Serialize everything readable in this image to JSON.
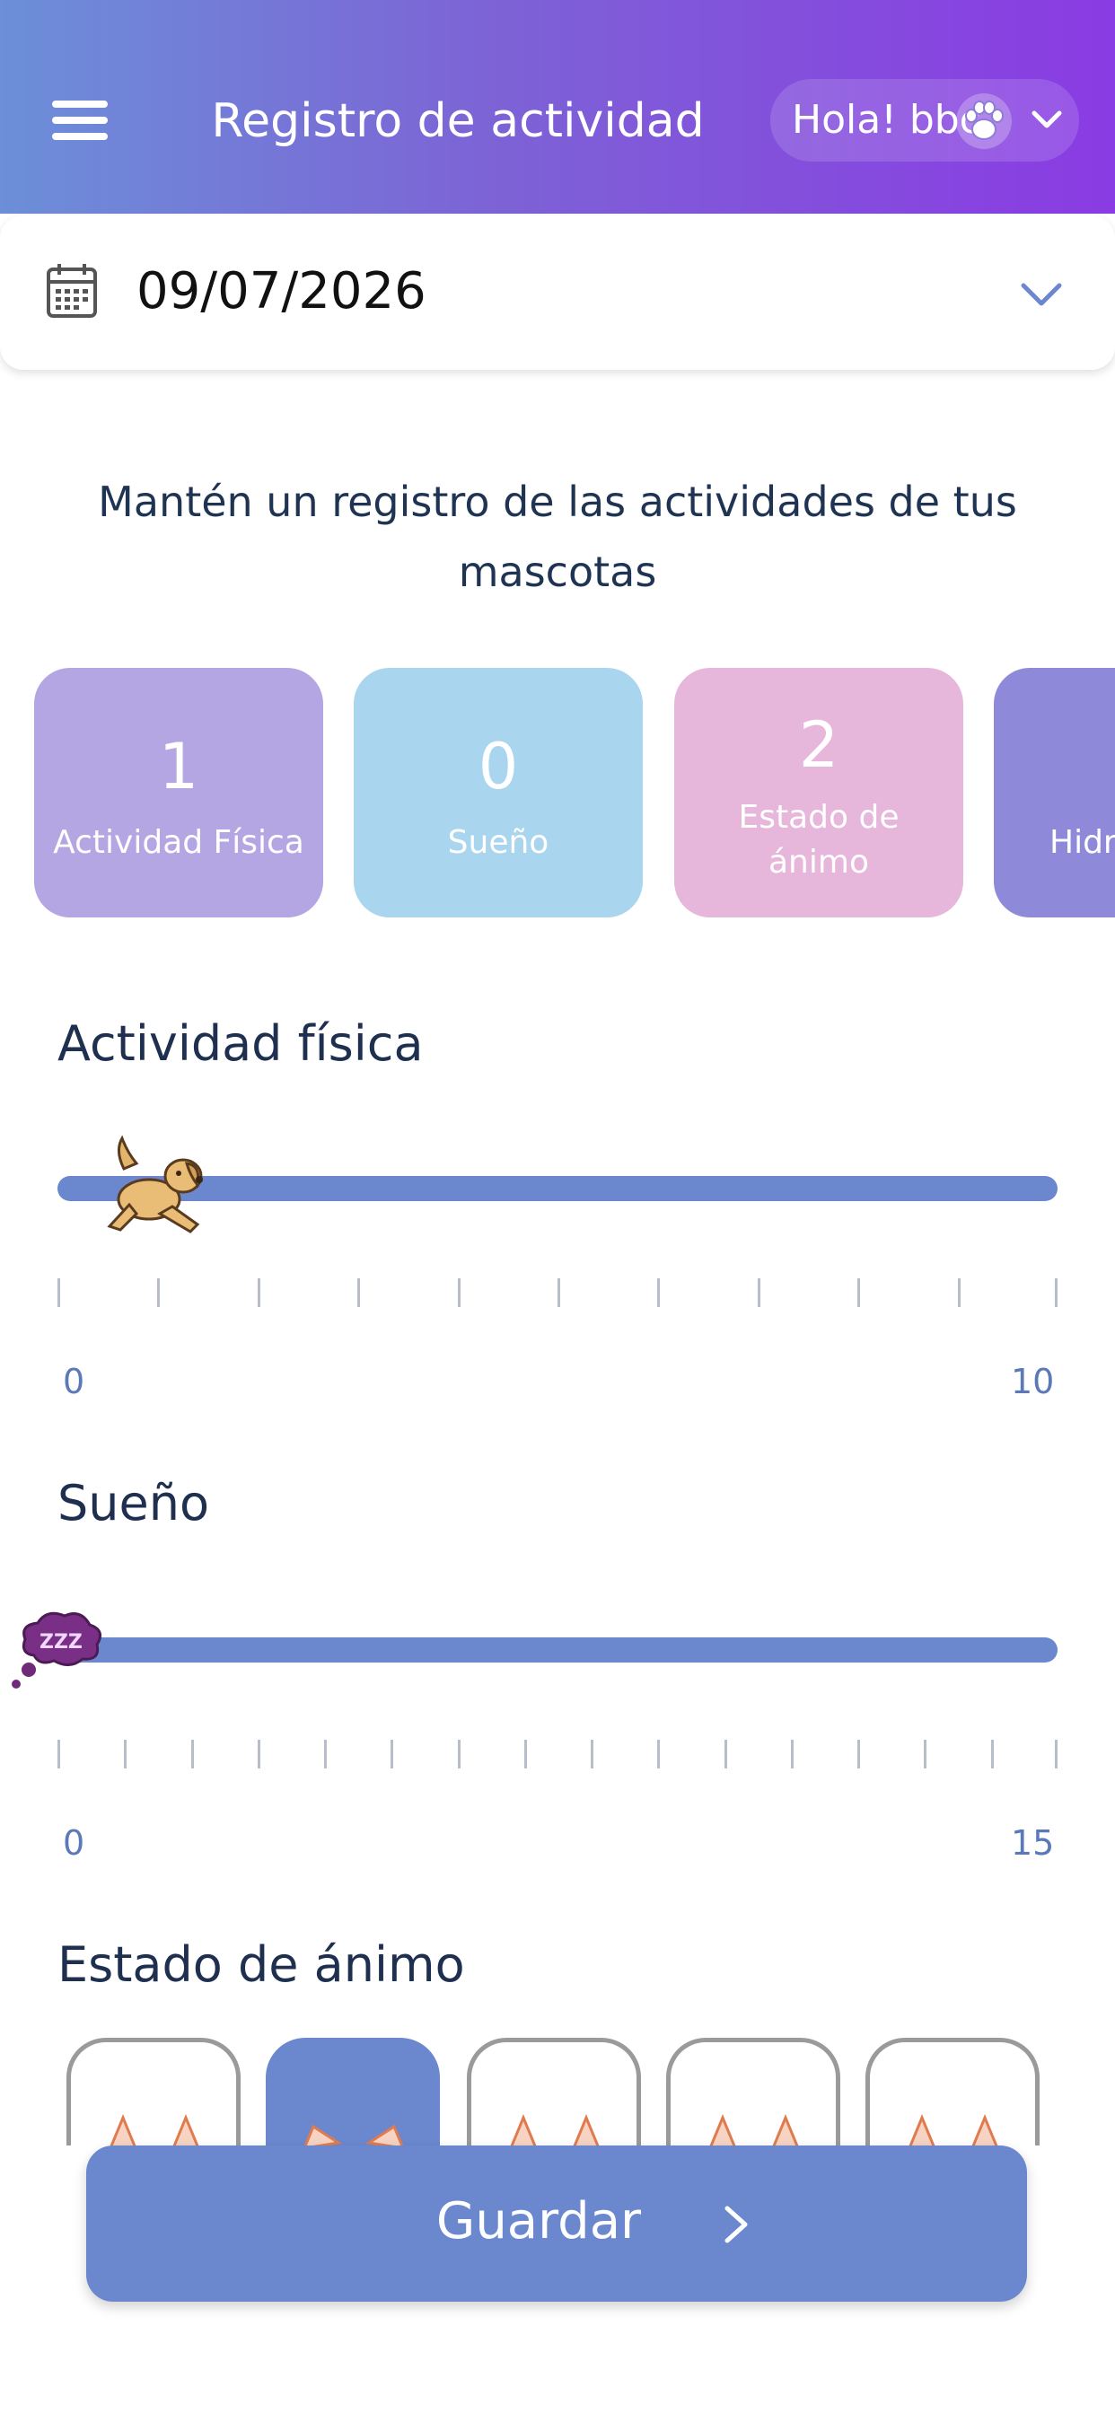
{
  "header": {
    "title": "Registro de actividad",
    "greeting": "Hola! bbc",
    "menu_icon": "hamburger-menu-icon",
    "user_icon": "paw-icon"
  },
  "date": {
    "value": "09/07/2026",
    "icon": "calendar-icon"
  },
  "subtitle": "Mantén un registro de las actividades de tus mascotas",
  "summary_cards": [
    {
      "count": "1",
      "label": "Actividad Física",
      "color": "#b4a6e3"
    },
    {
      "count": "0",
      "label": "Sueño",
      "color": "#a9d5ef"
    },
    {
      "count": "2",
      "label": "Estado de ánimo",
      "color": "#e6b7da"
    },
    {
      "count": "",
      "label": "Hidr",
      "color": "#8e8ad9"
    }
  ],
  "activity": {
    "title": "Actividad física",
    "min": "0",
    "max": "10",
    "value": 1,
    "range": [
      0,
      10
    ],
    "icon": "dog-icon"
  },
  "sleep": {
    "title": "Sueño",
    "min": "0",
    "max": "15",
    "value": 0,
    "range": [
      0,
      15
    ],
    "icon": "zzz-sleep-icon"
  },
  "mood": {
    "title": "Estado de ánimo",
    "options_count": 5,
    "selected_index": 1
  },
  "save_button": {
    "label": "Guardar"
  },
  "colors": {
    "accent": "#6b88cf",
    "header_start": "#6c8fd8",
    "header_end": "#8a3be3",
    "text": "#1e2f4f"
  }
}
